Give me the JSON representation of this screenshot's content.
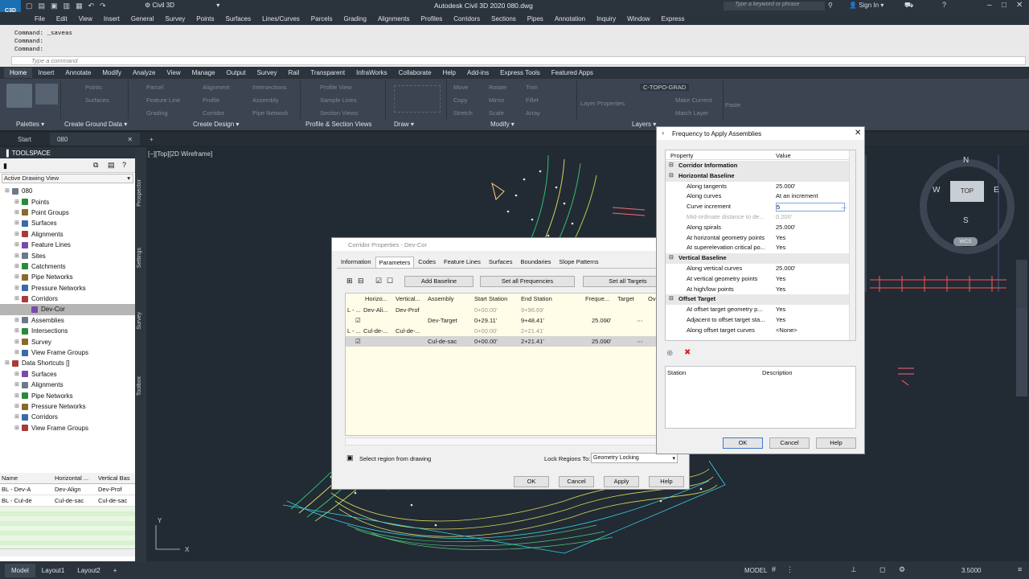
{
  "app": {
    "logo": "C3D",
    "workspace": "Civil 3D",
    "title": "Autodesk Civil 3D 2020   080.dwg",
    "search_placeholder": "Type a keyword or phrase",
    "sign_in": "Sign In"
  },
  "menubar": [
    "File",
    "Edit",
    "View",
    "Insert",
    "General",
    "Survey",
    "Points",
    "Surfaces",
    "Lines/Curves",
    "Parcels",
    "Grading",
    "Alignments",
    "Profiles",
    "Corridors",
    "Sections",
    "Pipes",
    "Annotation",
    "Inquiry",
    "Window",
    "Express"
  ],
  "command": {
    "lines": [
      "Command: _saveas",
      "Command:",
      "Command:"
    ],
    "placeholder": "Type a command"
  },
  "ribbon_tabs": [
    "Home",
    "Insert",
    "Annotate",
    "Modify",
    "Analyze",
    "View",
    "Manage",
    "Output",
    "Survey",
    "Rail",
    "Transparent",
    "InfraWorks",
    "Collaborate",
    "Help",
    "Add-ins",
    "Express Tools",
    "Featured Apps"
  ],
  "ribbon": {
    "tools": [
      "Points",
      "Surfaces",
      "Parcel",
      "Feature Line",
      "Grading",
      "Alignment",
      "Profile",
      "Corridor",
      "Intersections",
      "Assembly",
      "Pipe Network",
      "Profile View",
      "Sample Lines",
      "Section Views",
      "Move",
      "Copy",
      "Mirror",
      "Stretch",
      "Rotate",
      "Trim",
      "Fillet",
      "Array",
      "Scale",
      "Layer Properties",
      "C-TOPO-GRAD",
      "Make Current",
      "Match Layer",
      "Paste"
    ],
    "panels": [
      "Palettes",
      "Create Ground Data",
      "Create Design",
      "Profile & Section Views",
      "Draw",
      "Modify",
      "Layers"
    ]
  },
  "doc_tabs": [
    "Start",
    "080"
  ],
  "toolspace": {
    "title": "TOOLSPACE",
    "view": "Active Drawing View",
    "side_tabs": [
      "Prospector",
      "Settings",
      "Survey",
      "Toolbox"
    ],
    "tree": [
      {
        "label": "080",
        "level": 0
      },
      {
        "label": "Points",
        "level": 1
      },
      {
        "label": "Point Groups",
        "level": 1
      },
      {
        "label": "Surfaces",
        "level": 1
      },
      {
        "label": "Alignments",
        "level": 1
      },
      {
        "label": "Feature Lines",
        "level": 1
      },
      {
        "label": "Sites",
        "level": 1
      },
      {
        "label": "Catchments",
        "level": 1
      },
      {
        "label": "Pipe Networks",
        "level": 1
      },
      {
        "label": "Pressure Networks",
        "level": 1
      },
      {
        "label": "Corridors",
        "level": 1
      },
      {
        "label": "Dev-Cor",
        "level": 2
      },
      {
        "label": "Assemblies",
        "level": 1
      },
      {
        "label": "Intersections",
        "level": 1
      },
      {
        "label": "Survey",
        "level": 1
      },
      {
        "label": "View Frame Groups",
        "level": 1
      },
      {
        "label": "Data Shortcuts []",
        "level": 0
      },
      {
        "label": "Surfaces",
        "level": 1
      },
      {
        "label": "Alignments",
        "level": 1
      },
      {
        "label": "Pipe Networks",
        "level": 1
      },
      {
        "label": "Pressure Networks",
        "level": 1
      },
      {
        "label": "Corridors",
        "level": 1
      },
      {
        "label": "View Frame Groups",
        "level": 1
      }
    ],
    "table_headers": [
      "Name",
      "Horizontal ...",
      "Vertical Bas"
    ],
    "table_rows": [
      [
        "BL - Dev-A",
        "Dev-Align",
        "Dev-Prof"
      ],
      [
        "BL - Cul-de",
        "Cul-de-sac",
        "Cul-de-sac"
      ]
    ]
  },
  "viewport": {
    "label": "[−][Top][2D Wireframe]",
    "compass": {
      "n": "N",
      "s": "S",
      "e": "E",
      "w": "W",
      "top": "TOP",
      "wcs": "WCS"
    }
  },
  "corridor_dialog": {
    "title": "Corridor Properties - Dev-Cor",
    "tabs": [
      "Information",
      "Parameters",
      "Codes",
      "Feature Lines",
      "Surfaces",
      "Boundaries",
      "Slope Patterns"
    ],
    "buttons": {
      "add_baseline": "Add Baseline",
      "set_freq": "Set all Frequencies",
      "set_targets": "Set all Targets"
    },
    "columns": [
      "Horizo...",
      "Vertical...",
      "Assembly",
      "Start Station",
      "End Station",
      "Freque...",
      "Target",
      "Ov"
    ],
    "rows": [
      {
        "name": "L - ...",
        "h": "Dev-Ali...",
        "v": "Dev-Prof",
        "assembly": "",
        "start": "0+00.00'",
        "end": "9+96.69'",
        "freq": ""
      },
      {
        "name": "",
        "h": "",
        "v": "",
        "assembly": "Dev-Target",
        "start": "0+29.11'",
        "end": "9+48.41'",
        "freq": "25.000'"
      },
      {
        "name": "L - ...",
        "h": "Cul-de-...",
        "v": "Cul-de-...",
        "assembly": "",
        "start": "0+00.00'",
        "end": "2+21.41'",
        "freq": ""
      },
      {
        "name": "",
        "h": "",
        "v": "",
        "assembly": "Cul-de-sac",
        "start": "0+00.00'",
        "end": "2+21.41'",
        "freq": "25.000'"
      }
    ],
    "select_region": "Select region from drawing",
    "lock_label": "Lock Regions To:",
    "lock_value": "Geometry Locking",
    "ok": "OK",
    "cancel": "Cancel",
    "apply": "Apply",
    "help": "Help"
  },
  "freq_dialog": {
    "title": "Frequency to Apply Assemblies",
    "col_property": "Property",
    "col_value": "Value",
    "rows": [
      {
        "k": "Corridor Information",
        "v": "",
        "type": "cat"
      },
      {
        "k": "Horizontal Baseline",
        "v": "",
        "type": "cat"
      },
      {
        "k": "Along tangents",
        "v": "25.000'",
        "type": "item"
      },
      {
        "k": "Along curves",
        "v": "At an increment",
        "type": "item"
      },
      {
        "k": "Curve increment",
        "v": "5",
        "type": "edit"
      },
      {
        "k": "Mid-ordinate distance to de...",
        "v": "0.200'",
        "type": "dis"
      },
      {
        "k": "Along spirals",
        "v": "25.000'",
        "type": "item"
      },
      {
        "k": "At horizontal geometry points",
        "v": "Yes",
        "type": "item"
      },
      {
        "k": "At superelevation critical po...",
        "v": "Yes",
        "type": "item"
      },
      {
        "k": "Vertical Baseline",
        "v": "",
        "type": "cat"
      },
      {
        "k": "Along vertical curves",
        "v": "25.000'",
        "type": "item"
      },
      {
        "k": "At vertical geometry points",
        "v": "Yes",
        "type": "item"
      },
      {
        "k": "At high/low points",
        "v": "Yes",
        "type": "item"
      },
      {
        "k": "Offset Target",
        "v": "",
        "type": "cat"
      },
      {
        "k": "At offset target geometry p...",
        "v": "Yes",
        "type": "item"
      },
      {
        "k": "Adjacent to offset target sta...",
        "v": "Yes",
        "type": "item"
      },
      {
        "k": "Along offset target curves",
        "v": "<None>",
        "type": "item"
      }
    ],
    "list_headers": [
      "Station",
      "Description"
    ],
    "ok": "OK",
    "cancel": "Cancel",
    "help": "Help"
  },
  "status": {
    "tabs": [
      "Model",
      "Layout1",
      "Layout2"
    ],
    "model": "MODEL",
    "scale": "3.5000"
  },
  "colors": {
    "accent": "#0f6fc6",
    "dark": "#2b333d",
    "ribbon": "#3b4450"
  }
}
